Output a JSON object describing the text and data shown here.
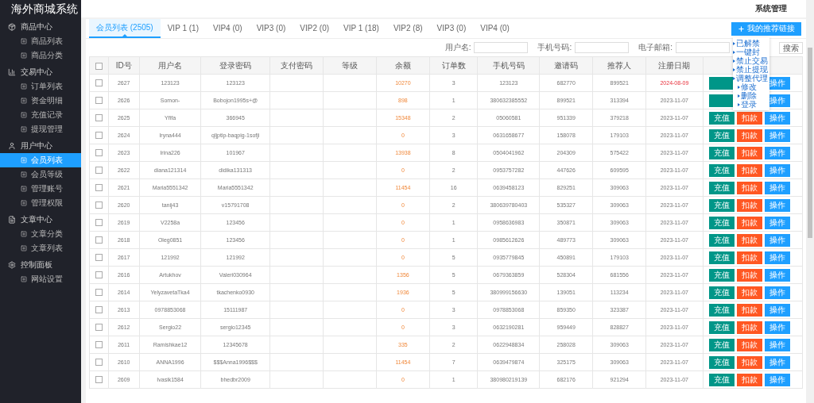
{
  "sidebar": {
    "title": "海外商城系统",
    "groups": [
      {
        "label": "商品中心",
        "kind": "goods",
        "items": [
          {
            "label": "商品列表",
            "selected": false
          },
          {
            "label": "商品分类",
            "selected": false
          }
        ]
      },
      {
        "label": "交易中心",
        "kind": "trade",
        "items": [
          {
            "label": "订单列表",
            "selected": false
          },
          {
            "label": "资金明细",
            "selected": false
          },
          {
            "label": "充值记录",
            "selected": false
          },
          {
            "label": "提现管理",
            "selected": false
          }
        ]
      },
      {
        "label": "用户中心",
        "kind": "user",
        "items": [
          {
            "label": "会员列表",
            "selected": true
          },
          {
            "label": "会员等级",
            "selected": false
          },
          {
            "label": "管理账号",
            "selected": false
          },
          {
            "label": "管理权限",
            "selected": false
          }
        ]
      },
      {
        "label": "文章中心",
        "kind": "article",
        "items": [
          {
            "label": "文章分类",
            "selected": false
          },
          {
            "label": "文章列表",
            "selected": false
          }
        ]
      },
      {
        "label": "控制面板",
        "kind": "control",
        "items": [
          {
            "label": "网站设置",
            "selected": false
          }
        ]
      }
    ]
  },
  "header": {
    "title": "系统管理"
  },
  "tabs": [
    {
      "label": "会员列表 (2505)",
      "selected": true
    },
    {
      "label": "VIP 1 (1)",
      "selected": false
    },
    {
      "label": "VIP4 (0)",
      "selected": false
    },
    {
      "label": "VIP3 (0)",
      "selected": false
    },
    {
      "label": "VIP2 (0)",
      "selected": false
    },
    {
      "label": "VIP 1 (18)",
      "selected": false
    },
    {
      "label": "VIP2 (8)",
      "selected": false
    },
    {
      "label": "VIP3 (0)",
      "selected": false
    },
    {
      "label": "VIP4 (0)",
      "selected": false
    }
  ],
  "link_button": "我的推荐链接",
  "search": {
    "fields": [
      {
        "label": "用户名:"
      },
      {
        "label": "手机号码:"
      },
      {
        "label": "电子邮箱:"
      }
    ],
    "button": "搜索"
  },
  "row_menu": [
    {
      "label": "已解禁"
    },
    {
      "label": "一键封"
    },
    {
      "label": "禁止交易"
    },
    {
      "label": "禁止提现"
    },
    {
      "label": "调整代理",
      "children": [
        {
          "label": "修改"
        },
        {
          "label": "删除"
        },
        {
          "label": "登录"
        }
      ]
    }
  ],
  "table": {
    "select_all_checked": false,
    "columns": [
      "ID号",
      "用户名",
      "登录密码",
      "支付密码",
      "等级",
      "余额",
      "订单数",
      "手机号码",
      "邀请码",
      "推荐人",
      "注册日期"
    ],
    "rows": [
      {
        "checked": false,
        "highlight": true,
        "cells": [
          "2627",
          "123123",
          "123123",
          "",
          "",
          "10270",
          "3",
          "123123",
          "682770",
          "899521",
          "2024-08-09"
        ],
        "actions": [
          {
            "kind": "charge"
          },
          {
            "kind": "operate",
            "label": "操作"
          }
        ]
      },
      {
        "checked": false,
        "highlight": false,
        "cells": [
          "2626",
          "Somon-",
          "Bobojon1995s+@",
          "",
          "",
          "898",
          "1",
          "380632385552",
          "899521",
          "313394",
          "2023-11-07"
        ],
        "actions": [
          {
            "kind": "charge"
          },
          {
            "kind": "operate",
            "label": "操作"
          }
        ]
      },
      {
        "checked": false,
        "highlight": false,
        "cells": [
          "2625",
          "Yfifa",
          "366945",
          "",
          "",
          "15348",
          "2",
          "05060581",
          "951339",
          "379218",
          "2023-11-07"
        ],
        "actions": [
          {
            "kind": "charge",
            "label": "充值"
          },
          {
            "kind": "deduct",
            "label": "扣款"
          },
          {
            "kind": "operate",
            "label": "操作"
          }
        ]
      },
      {
        "checked": false,
        "highlight": false,
        "cells": [
          "2624",
          "Iryna444",
          "qljptip-baqpig-1sofji",
          "",
          "",
          "0",
          "3",
          "0631658677",
          "158078",
          "179103",
          "2023-11-07"
        ],
        "actions": [
          {
            "kind": "charge",
            "label": "充值"
          },
          {
            "kind": "deduct",
            "label": "扣款"
          },
          {
            "kind": "operate",
            "label": "操作"
          }
        ]
      },
      {
        "checked": false,
        "highlight": false,
        "cells": [
          "2623",
          "Irina226",
          "101967",
          "",
          "",
          "13938",
          "8",
          "0504041962",
          "204309",
          "575422",
          "2023-11-07"
        ],
        "actions": [
          {
            "kind": "charge",
            "label": "充值"
          },
          {
            "kind": "deduct",
            "label": "扣款"
          },
          {
            "kind": "operate",
            "label": "操作"
          }
        ]
      },
      {
        "checked": false,
        "highlight": false,
        "cells": [
          "2622",
          "diana121314",
          "didika131313",
          "",
          "",
          "0",
          "2",
          "0953757282",
          "447626",
          "609595",
          "2023-11-07"
        ],
        "actions": [
          {
            "kind": "charge",
            "label": "充值"
          },
          {
            "kind": "deduct",
            "label": "扣款"
          },
          {
            "kind": "operate",
            "label": "操作"
          }
        ]
      },
      {
        "checked": false,
        "highlight": false,
        "cells": [
          "2621",
          "Maria5551342",
          "Maria5551342",
          "",
          "",
          "11454",
          "16",
          "0639458123",
          "829251",
          "309063",
          "2023-11-07"
        ],
        "actions": [
          {
            "kind": "charge",
            "label": "充值"
          },
          {
            "kind": "deduct",
            "label": "扣款"
          },
          {
            "kind": "operate",
            "label": "操作"
          }
        ]
      },
      {
        "checked": false,
        "highlight": false,
        "cells": [
          "2620",
          "tanij43",
          "v15791708",
          "",
          "",
          "0",
          "2",
          "380639780403",
          "535327",
          "309063",
          "2023-11-07"
        ],
        "actions": [
          {
            "kind": "charge",
            "label": "充值"
          },
          {
            "kind": "deduct",
            "label": "扣款"
          },
          {
            "kind": "operate",
            "label": "操作"
          }
        ]
      },
      {
        "checked": false,
        "highlight": false,
        "cells": [
          "2619",
          "V2258a",
          "123456",
          "",
          "",
          "0",
          "1",
          "0958636983",
          "350871",
          "309063",
          "2023-11-07"
        ],
        "actions": [
          {
            "kind": "charge",
            "label": "充值"
          },
          {
            "kind": "deduct",
            "label": "扣款"
          },
          {
            "kind": "operate",
            "label": "操作"
          }
        ]
      },
      {
        "checked": false,
        "highlight": false,
        "cells": [
          "2618",
          "Oleg0851",
          "123456",
          "",
          "",
          "0",
          "1",
          "0985612626",
          "489773",
          "309063",
          "2023-11-07"
        ],
        "actions": [
          {
            "kind": "charge",
            "label": "充值"
          },
          {
            "kind": "deduct",
            "label": "扣款"
          },
          {
            "kind": "operate",
            "label": "操作"
          }
        ]
      },
      {
        "checked": false,
        "highlight": false,
        "cells": [
          "2617",
          "121992",
          "121992",
          "",
          "",
          "0",
          "5",
          "0935779845",
          "450891",
          "179103",
          "2023-11-07"
        ],
        "actions": [
          {
            "kind": "charge",
            "label": "充值"
          },
          {
            "kind": "deduct",
            "label": "扣款"
          },
          {
            "kind": "operate",
            "label": "操作"
          }
        ]
      },
      {
        "checked": false,
        "highlight": false,
        "cells": [
          "2616",
          "Artukhov",
          "Valeri030964",
          "",
          "",
          "1356",
          "5",
          "0679363859",
          "528304",
          "681556",
          "2023-11-07"
        ],
        "actions": [
          {
            "kind": "charge",
            "label": "充值"
          },
          {
            "kind": "deduct",
            "label": "扣款"
          },
          {
            "kind": "operate",
            "label": "操作"
          }
        ]
      },
      {
        "checked": false,
        "highlight": false,
        "cells": [
          "2614",
          "YelyzavetaTka4",
          "tkachenko0930",
          "",
          "",
          "1936",
          "5",
          "380999156630",
          "139051",
          "113234",
          "2023-11-07"
        ],
        "actions": [
          {
            "kind": "charge",
            "label": "充值"
          },
          {
            "kind": "deduct",
            "label": "扣款"
          },
          {
            "kind": "operate",
            "label": "操作"
          }
        ]
      },
      {
        "checked": false,
        "highlight": false,
        "cells": [
          "2613",
          "0978853068",
          "15111987",
          "",
          "",
          "0",
          "3",
          "0978853068",
          "859350",
          "323387",
          "2023-11-07"
        ],
        "actions": [
          {
            "kind": "charge",
            "label": "充值"
          },
          {
            "kind": "deduct",
            "label": "扣款"
          },
          {
            "kind": "operate",
            "label": "操作"
          }
        ]
      },
      {
        "checked": false,
        "highlight": false,
        "cells": [
          "2612",
          "Sergio22",
          "sergio12345",
          "",
          "",
          "0",
          "3",
          "0632190281",
          "959449",
          "828827",
          "2023-11-07"
        ],
        "actions": [
          {
            "kind": "charge",
            "label": "充值"
          },
          {
            "kind": "deduct",
            "label": "扣款"
          },
          {
            "kind": "operate",
            "label": "操作"
          }
        ]
      },
      {
        "checked": false,
        "highlight": false,
        "cells": [
          "2611",
          "Ramishkae12",
          "12345678",
          "",
          "",
          "335",
          "2",
          "0622948834",
          "258028",
          "309063",
          "2023-11-07"
        ],
        "actions": [
          {
            "kind": "charge",
            "label": "充值"
          },
          {
            "kind": "deduct",
            "label": "扣款"
          },
          {
            "kind": "operate",
            "label": "操作"
          }
        ]
      },
      {
        "checked": false,
        "highlight": false,
        "cells": [
          "2610",
          "ANNA1996",
          "$$$Anna1996$$$",
          "",
          "",
          "11454",
          "7",
          "0639479874",
          "325175",
          "309063",
          "2023-11-07"
        ],
        "actions": [
          {
            "kind": "charge",
            "label": "充值"
          },
          {
            "kind": "deduct",
            "label": "扣款"
          },
          {
            "kind": "operate",
            "label": "操作"
          }
        ]
      },
      {
        "checked": false,
        "highlight": false,
        "cells": [
          "2609",
          "Ivasik1584",
          "bhedbr2009",
          "",
          "",
          "0",
          "1",
          "380980219139",
          "682176",
          "921294",
          "2023-11-07"
        ],
        "actions": [
          {
            "kind": "charge",
            "label": "充值"
          },
          {
            "kind": "deduct",
            "label": "扣款"
          },
          {
            "kind": "operate",
            "label": "操作"
          }
        ]
      }
    ]
  }
}
